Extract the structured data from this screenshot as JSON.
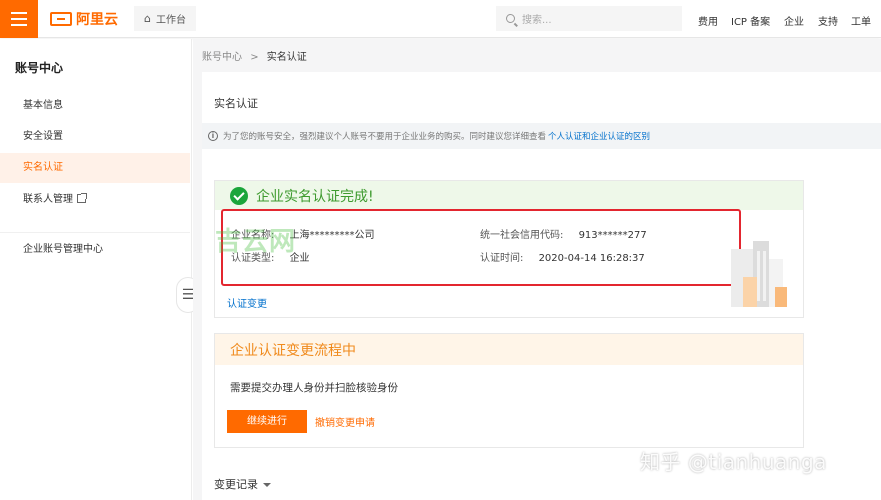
{
  "header": {
    "logo_text": "阿里云",
    "workbench": "工作台",
    "search_placeholder": "搜索...",
    "nav": [
      "费用",
      "ICP 备案",
      "企业",
      "支持",
      "工单"
    ]
  },
  "sidebar": {
    "title": "账号中心",
    "items": [
      {
        "label": "基本信息"
      },
      {
        "label": "安全设置"
      },
      {
        "label": "实名认证"
      },
      {
        "label": "联系人管理"
      },
      {
        "label": "企业账号管理中心"
      }
    ],
    "toggle_glyph": "☰"
  },
  "breadcrumb": {
    "root": "账号中心",
    "sep": ">",
    "current": "实名认证"
  },
  "page": {
    "title": "实名认证",
    "notice_text": "为了您的账号安全，强烈建议个人账号不要用于企业业务的购买。同时建议您详细查看",
    "notice_link": "个人认证和企业认证的区别"
  },
  "verified_card": {
    "title": "企业实名认证完成!",
    "company_name_label": "企业名称:",
    "company_name": "上海*********公司",
    "type_label": "认证类型:",
    "type": "企业",
    "credit_code_label": "统一社会信用代码:",
    "credit_code": "913******277",
    "time_label": "认证时间:",
    "time": "2020-04-14 16:28:37",
    "change_link": "认证变更",
    "watermark": "吉云网"
  },
  "change_card": {
    "title": "企业认证变更流程中",
    "desc": "需要提交办理人身份并扫脸核验身份",
    "continue_btn": "继续进行",
    "cancel_link": "撤销变更申请"
  },
  "history": {
    "label": "变更记录"
  },
  "overlay": {
    "zhihu_watermark": "知乎 @tianhuanga"
  },
  "colors": {
    "accent": "#ff6a00",
    "success": "#1ba53b",
    "warning_title": "#f08a1c",
    "link": "#0070cc",
    "highlight_box": "#e3262f"
  }
}
